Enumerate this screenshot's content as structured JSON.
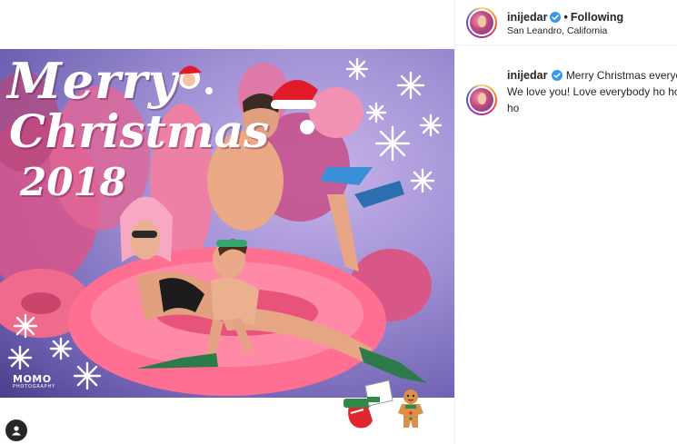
{
  "photo": {
    "title_line1": "Merry",
    "title_line2": "Christmas",
    "title_line3": "2018",
    "watermark_line1": "MOMO",
    "watermark_line2": "PHOTOGRAPHY"
  },
  "post_header": {
    "username": "inijedar",
    "separator": "•",
    "follow_status": "Following",
    "location": "San Leandro, California"
  },
  "caption": {
    "username": "inijedar",
    "line1": "Merry Christmas everyon",
    "line2": "We love you! Love everybody ho ho",
    "line3": "ho"
  },
  "colors": {
    "verified_badge": "#3897f0",
    "text_primary": "#262626",
    "border": "#efefef"
  },
  "icons": {
    "verified": "verified-badge-icon",
    "tagged_user": "user-icon"
  }
}
